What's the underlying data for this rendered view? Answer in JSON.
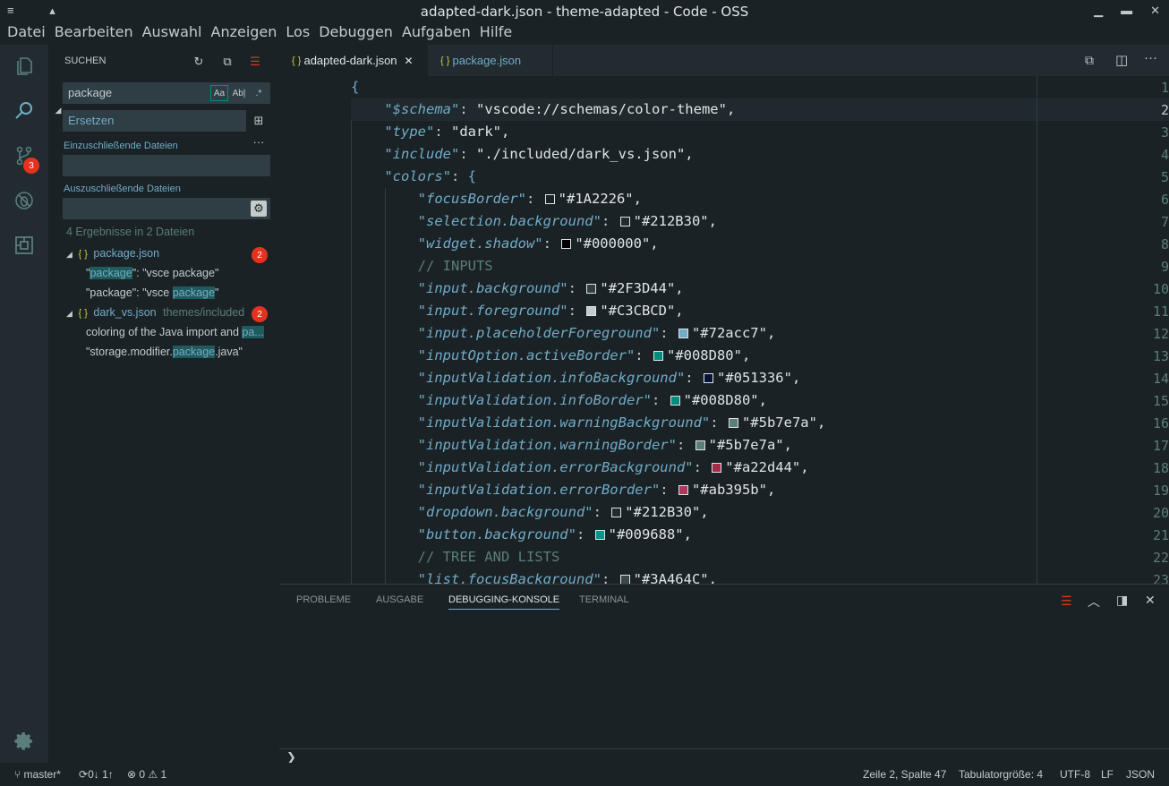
{
  "window": {
    "title": "adapted-dark.json - theme-adapted - Code - OSS"
  },
  "menu": [
    "Datei",
    "Bearbeiten",
    "Auswahl",
    "Anzeigen",
    "Los",
    "Debuggen",
    "Aufgaben",
    "Hilfe"
  ],
  "activity": {
    "scm_badge": "3"
  },
  "sidebar": {
    "title": "SUCHEN",
    "search_value": "package",
    "opt_case": "Aa",
    "opt_word": "Ab|",
    "opt_regex": ".*",
    "replace_placeholder": "Ersetzen",
    "include_label": "Einzuschließende Dateien",
    "exclude_label": "Auszuschließende Dateien",
    "summary": "4 Ergebnisse in 2 Dateien",
    "files": [
      {
        "name": "package.json",
        "path": "",
        "count": "2",
        "matches": [
          {
            "pre": "\"",
            "hit": "package",
            "post": "\": \"vsce package\""
          },
          {
            "pre": "\"package\": \"vsce ",
            "hit": "package",
            "post": "\""
          }
        ]
      },
      {
        "name": "dark_vs.json",
        "path": "themes/included",
        "count": "2",
        "matches": [
          {
            "pre": "coloring of the Java import and ",
            "hit": "pa...",
            "post": ""
          },
          {
            "pre": "\"storage.modifier.",
            "hit": "package",
            "post": ".java\""
          }
        ]
      }
    ]
  },
  "editor": {
    "tabs": [
      {
        "label": "adapted-dark.json",
        "active": true
      },
      {
        "label": "package.json",
        "active": false
      }
    ],
    "line_numbers": [
      "1",
      "2",
      "3",
      "4",
      "5",
      "6",
      "7",
      "8",
      "9",
      "10",
      "11",
      "12",
      "13",
      "14",
      "15",
      "16",
      "17",
      "18",
      "19",
      "20",
      "21",
      "22",
      "23"
    ],
    "lines": [
      {
        "indent": 0,
        "raw": "{"
      },
      {
        "indent": 1,
        "key": "$schema",
        "val": "\"vscode://schemas/color-theme\","
      },
      {
        "indent": 1,
        "key": "type",
        "val": "\"dark\","
      },
      {
        "indent": 1,
        "key": "include",
        "val": "\"./included/dark_vs.json\","
      },
      {
        "indent": 1,
        "key": "colors",
        "val": "{",
        "brace": true
      },
      {
        "indent": 2,
        "key": "focusBorder",
        "val": "\"#1A2226\",",
        "color": "#1A2226"
      },
      {
        "indent": 2,
        "key": "selection.background",
        "val": "\"#212B30\",",
        "color": "#212B30"
      },
      {
        "indent": 2,
        "key": "widget.shadow",
        "val": "\"#000000\",",
        "color": "#000000"
      },
      {
        "indent": 2,
        "comment": "// INPUTS"
      },
      {
        "indent": 2,
        "key": "input.background",
        "val": "\"#2F3D44\",",
        "color": "#2F3D44"
      },
      {
        "indent": 2,
        "key": "input.foreground",
        "val": "\"#C3CBCD\",",
        "color": "#C3CBCD"
      },
      {
        "indent": 2,
        "key": "input.placeholderForeground",
        "val": "\"#72acc7\",",
        "color": "#72acc7"
      },
      {
        "indent": 2,
        "key": "inputOption.activeBorder",
        "val": "\"#008D80\",",
        "color": "#008D80"
      },
      {
        "indent": 2,
        "key": "inputValidation.infoBackground",
        "val": "\"#051336\",",
        "color": "#051336"
      },
      {
        "indent": 2,
        "key": "inputValidation.infoBorder",
        "val": "\"#008D80\",",
        "color": "#008D80"
      },
      {
        "indent": 2,
        "key": "inputValidation.warningBackground",
        "val": "\"#5b7e7a\",",
        "color": "#5b7e7a"
      },
      {
        "indent": 2,
        "key": "inputValidation.warningBorder",
        "val": "\"#5b7e7a\",",
        "color": "#5b7e7a"
      },
      {
        "indent": 2,
        "key": "inputValidation.errorBackground",
        "val": "\"#a22d44\",",
        "color": "#a22d44"
      },
      {
        "indent": 2,
        "key": "inputValidation.errorBorder",
        "val": "\"#ab395b\",",
        "color": "#ab395b"
      },
      {
        "indent": 2,
        "key": "dropdown.background",
        "val": "\"#212B30\",",
        "color": "#212B30"
      },
      {
        "indent": 2,
        "key": "button.background",
        "val": "\"#009688\",",
        "color": "#009688"
      },
      {
        "indent": 2,
        "comment": "// TREE AND LISTS"
      },
      {
        "indent": 2,
        "key": "list.focusBackground",
        "val": "\"#3A464C\",",
        "color": "#3A464C"
      }
    ]
  },
  "panel": {
    "tabs": [
      "PROBLEME",
      "AUSGABE",
      "DEBUGGING-KONSOLE",
      "TERMINAL"
    ],
    "active": "DEBUGGING-KONSOLE",
    "prompt": "❯"
  },
  "status": {
    "branch": "master*",
    "sync": "0↓ 1↑",
    "errors": "0",
    "warnings": "1",
    "position": "Zeile 2, Spalte 47",
    "tabsize": "Tabulatorgröße: 4",
    "encoding": "UTF-8",
    "eol": "LF",
    "language": "JSON"
  },
  "colors": {
    "accent": "#008d80",
    "bg": "#1a2226",
    "sidebar": "#212b30",
    "key": "#72acc7",
    "badge": "#e5321f"
  }
}
